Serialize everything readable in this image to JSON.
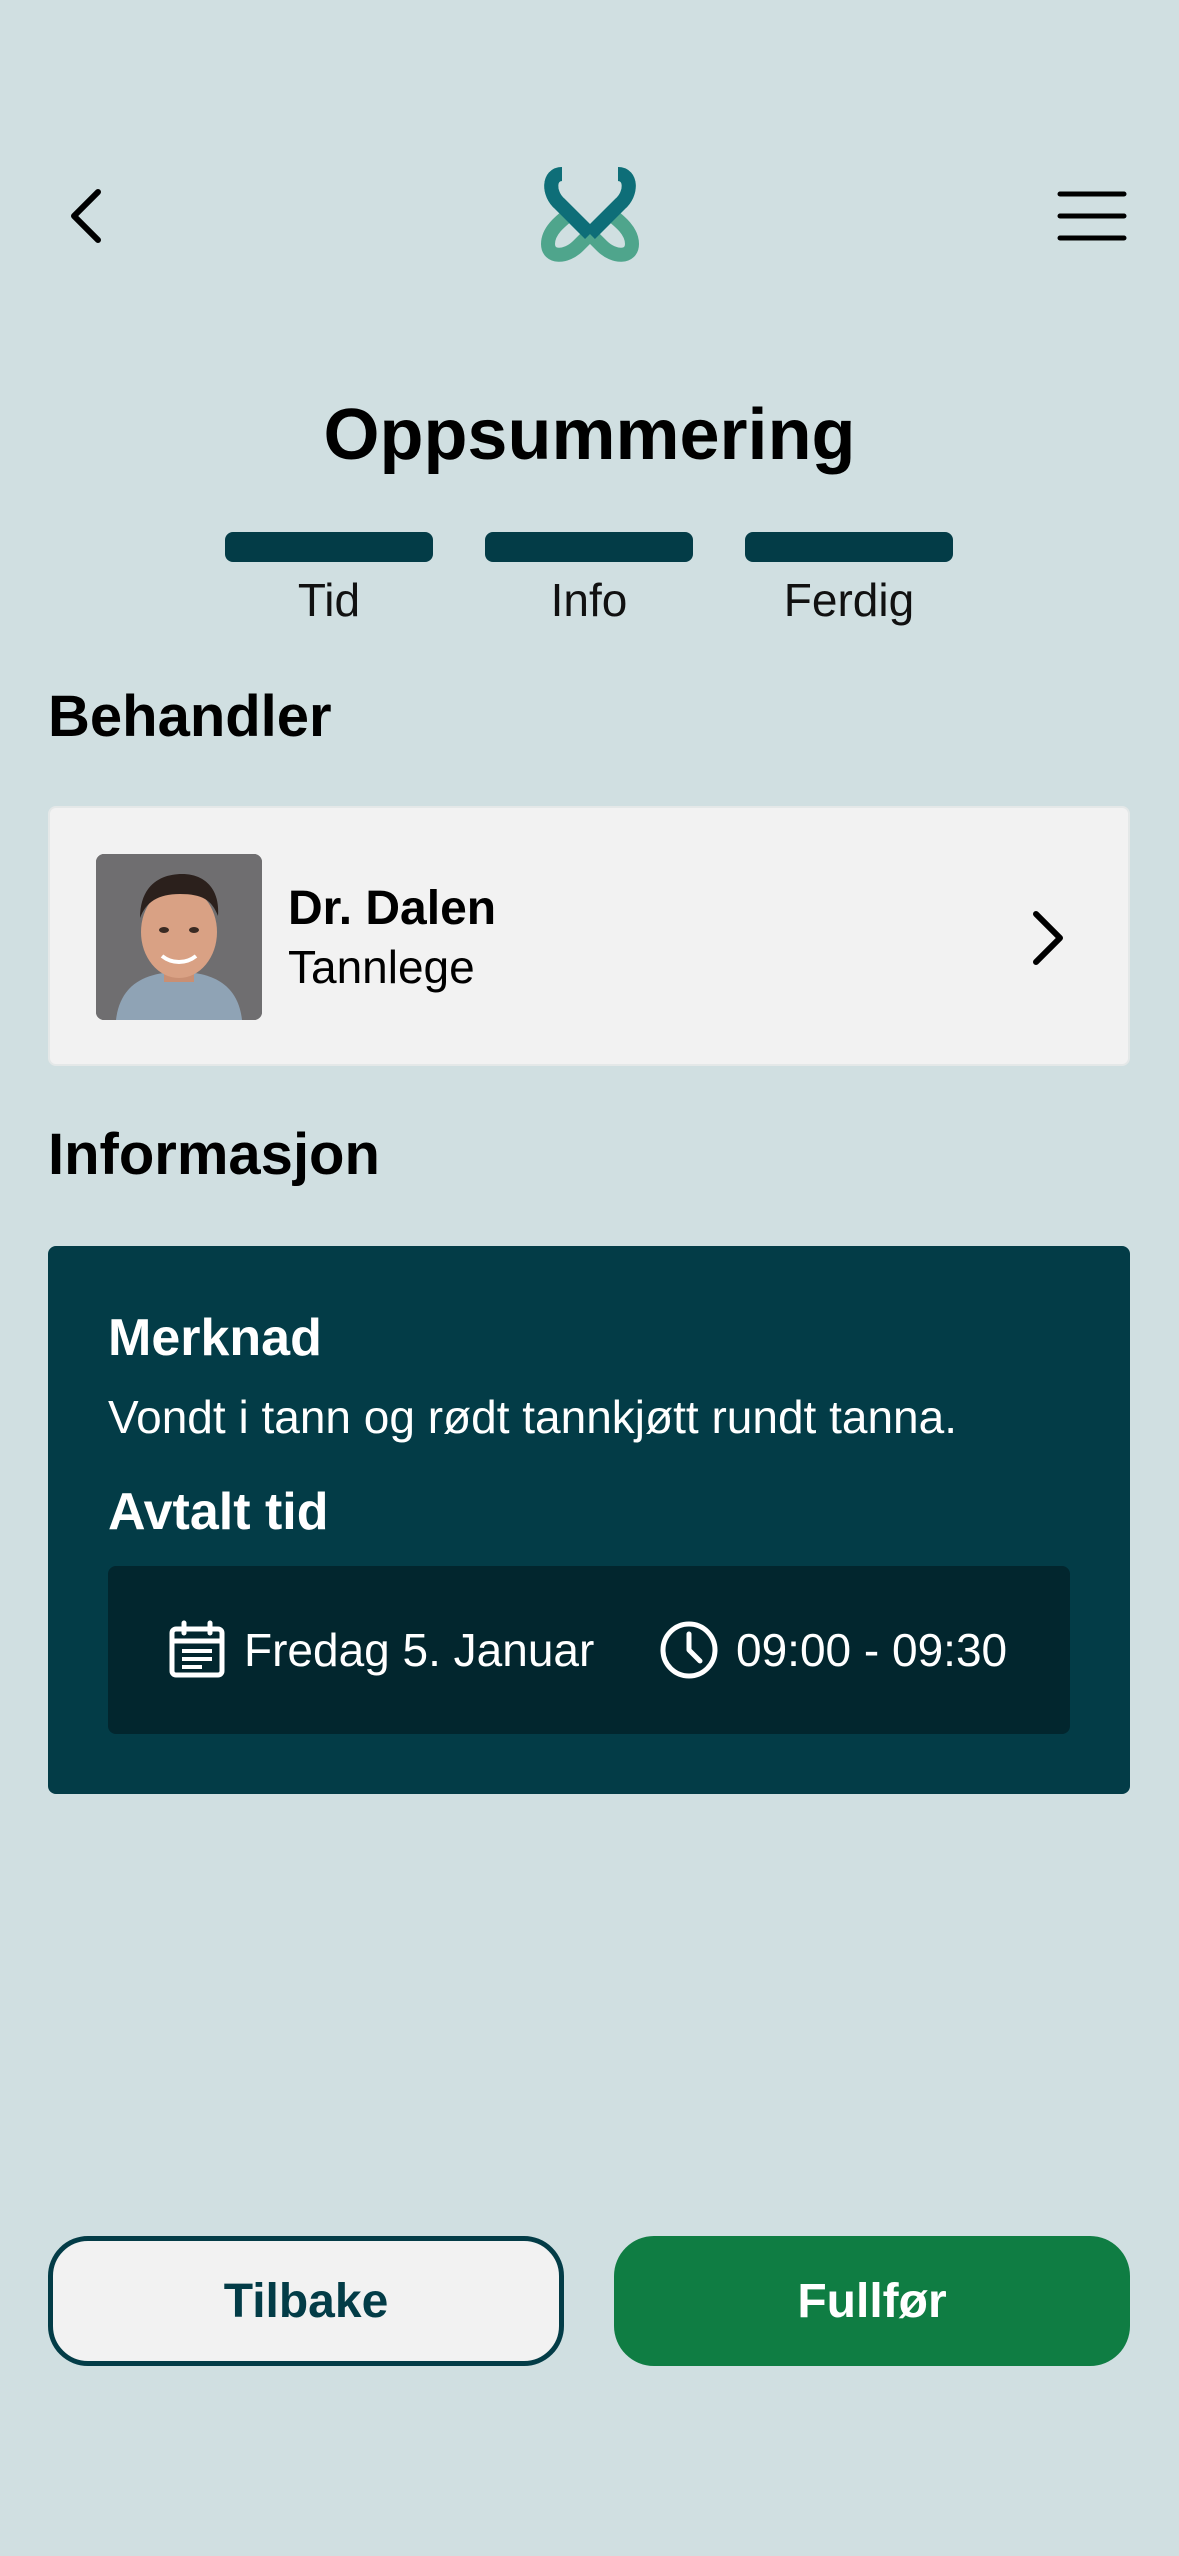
{
  "header": {
    "title": "Oppsummering"
  },
  "stepper": {
    "steps": [
      {
        "label": "Tid"
      },
      {
        "label": "Info"
      },
      {
        "label": "Ferdig"
      }
    ]
  },
  "provider_section": {
    "title": "Behandler",
    "name": "Dr. Dalen",
    "role": "Tannlege"
  },
  "info_section": {
    "title": "Informasjon",
    "note_title": "Merknad",
    "note_text": "Vondt i tann og rødt tannkjøtt rundt tanna.",
    "time_title": "Avtalt tid",
    "date": "Fredag 5. Januar",
    "time": "09:00 - 09:30"
  },
  "buttons": {
    "back_label": "Tilbake",
    "finish_label": "Fullfør"
  },
  "icons": {
    "back": "chevron-left-icon",
    "menu": "hamburger-menu-icon",
    "logo": "logo-icon",
    "provider_chevron": "chevron-right-icon",
    "calendar": "calendar-icon",
    "clock": "clock-icon"
  },
  "colors": {
    "background": "#D0DFE1",
    "primary_dark": "#033C47",
    "accent_green": "#0F7D43",
    "logo_teal": "#0E6E78",
    "logo_green": "#4FA58C",
    "card_light": "#F2F2F2"
  }
}
